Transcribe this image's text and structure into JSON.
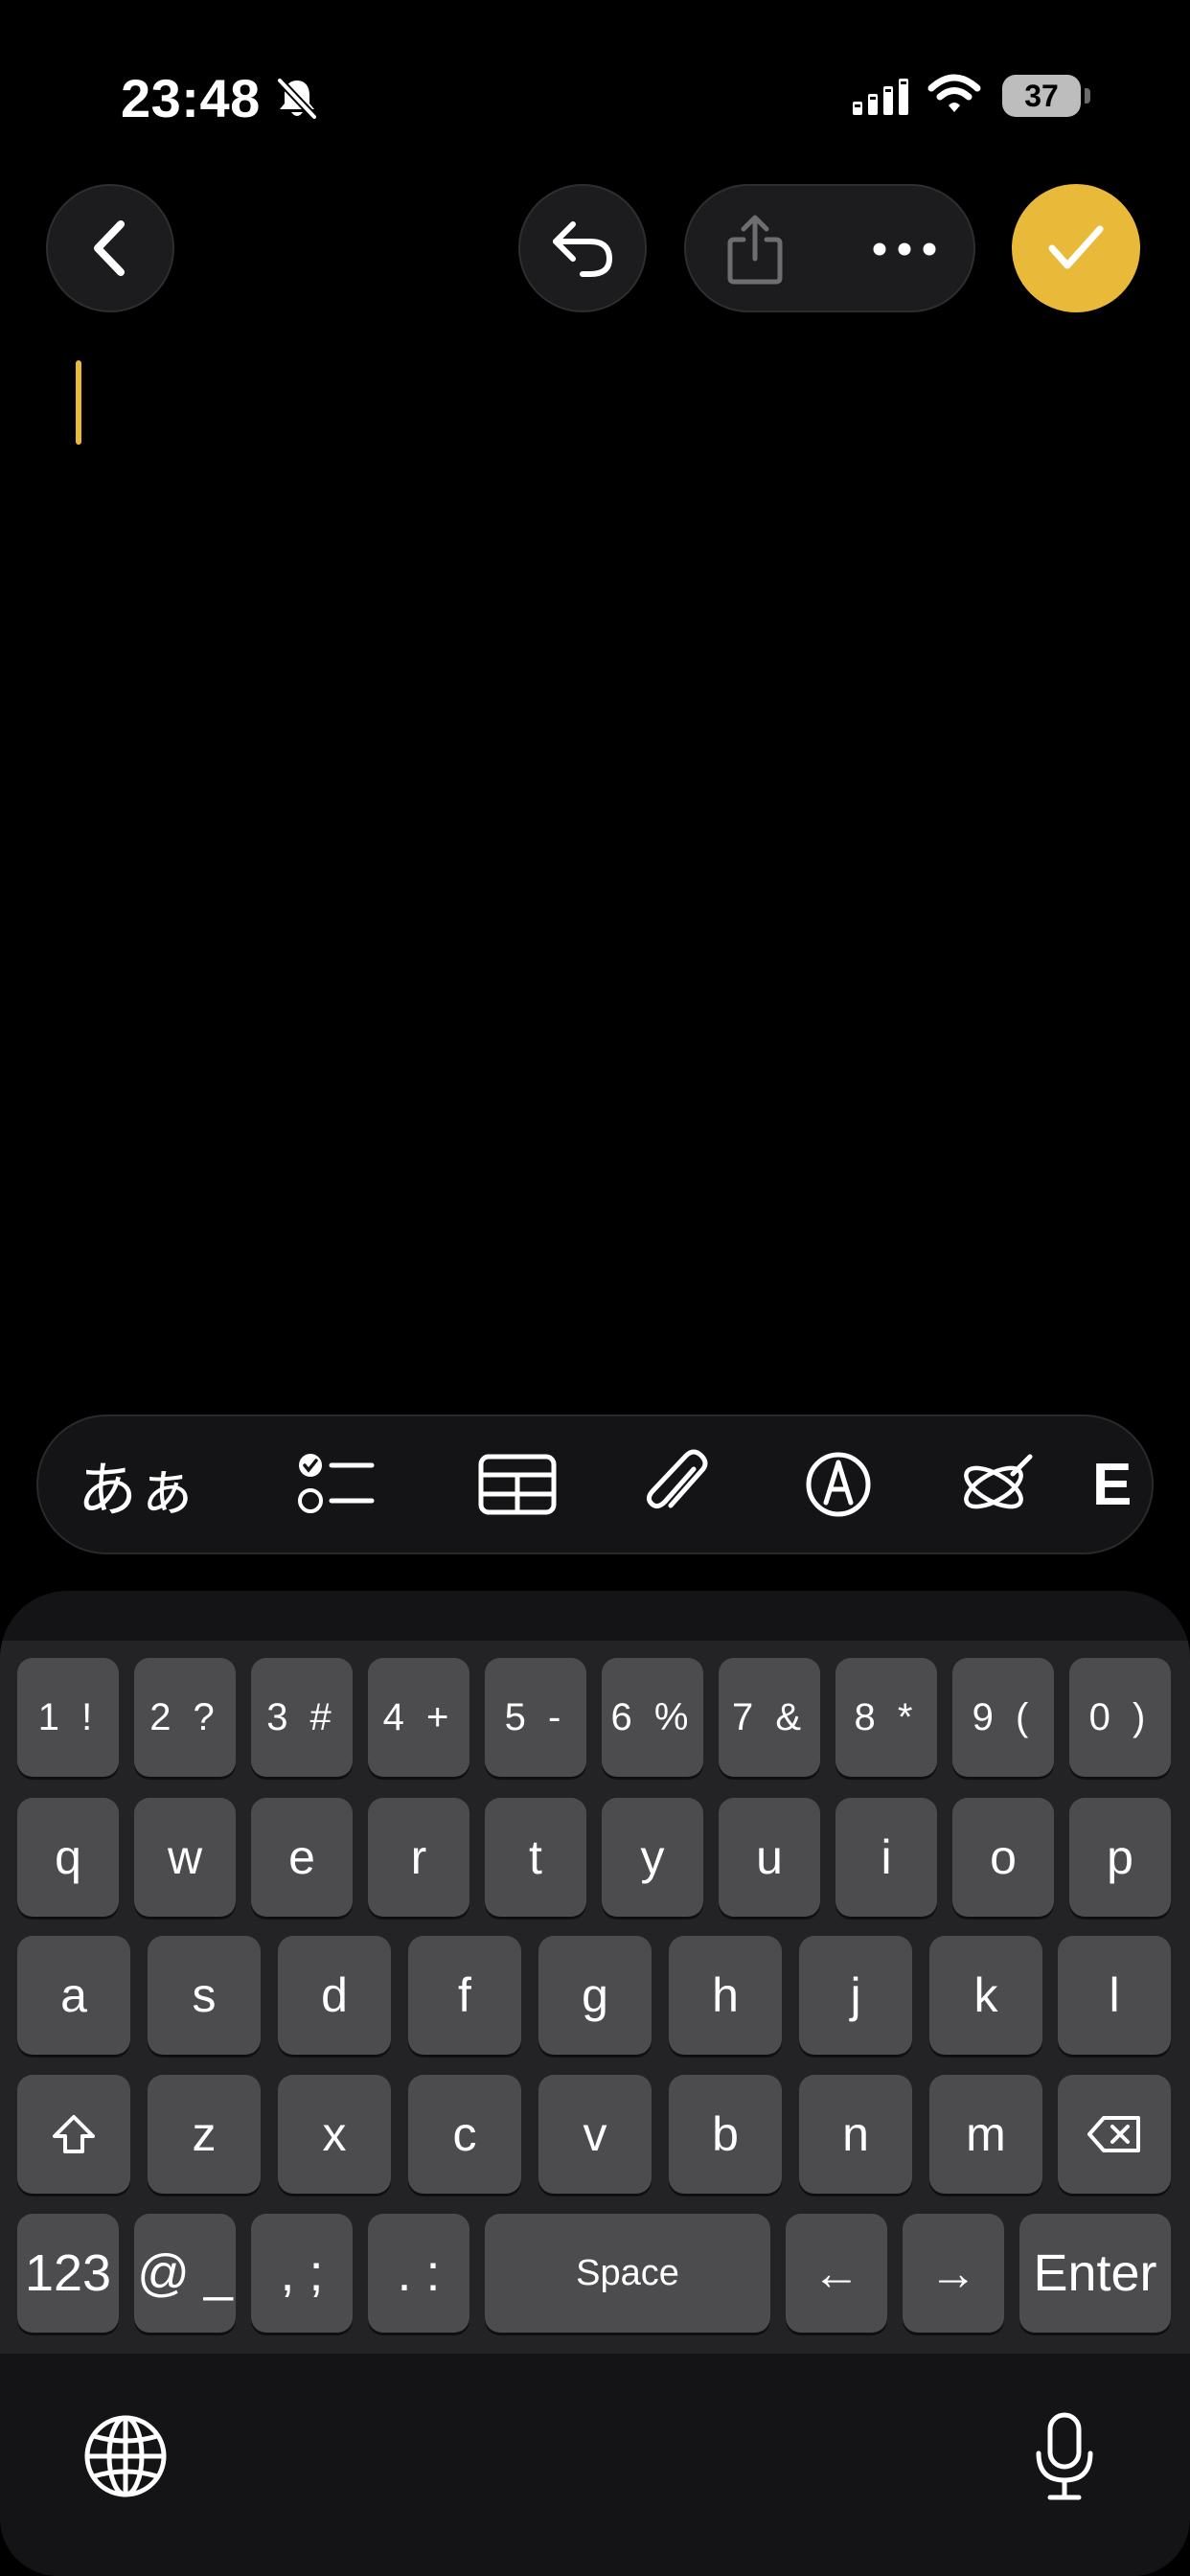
{
  "status_bar": {
    "time": "23:48",
    "battery_level": "37",
    "icons": [
      "bell-slash-icon",
      "cellular-signal-icon",
      "wifi-icon",
      "battery-icon"
    ]
  },
  "toolbar": {
    "icons": [
      "chevron-left-icon",
      "undo-arrow-icon",
      "share-icon",
      "ellipsis-icon",
      "checkmark-icon"
    ],
    "accent_color": "#e9b93a"
  },
  "format_toolbar": {
    "text_style_label": "あぁ",
    "icons": [
      "checklist-icon",
      "table-icon",
      "paperclip-icon",
      "markup-pen-icon",
      "writing-tools-icon"
    ],
    "partial_label": "E"
  },
  "keyboard": {
    "row_numbers": [
      "1 !",
      "2 ?",
      "3 #",
      "4 +",
      "5 -",
      "6 %",
      "7 &",
      "8 *",
      "9 (",
      "0 )"
    ],
    "row_top": [
      "q",
      "w",
      "e",
      "r",
      "t",
      "y",
      "u",
      "i",
      "o",
      "p"
    ],
    "row_middle": [
      "a",
      "s",
      "d",
      "f",
      "g",
      "h",
      "j",
      "k",
      "l"
    ],
    "row_bottom": [
      "z",
      "x",
      "c",
      "v",
      "b",
      "n",
      "m"
    ],
    "bottom_bar": {
      "mode_label": "123",
      "at_label": "@ _",
      "comma_label": ", ;",
      "period_label": ". :",
      "space_label": "Space",
      "left_arrow": "←",
      "right_arrow": "→",
      "enter_label": "Enter"
    },
    "icons": [
      "shift-icon",
      "delete-backward-icon",
      "globe-icon",
      "microphone-icon"
    ]
  }
}
